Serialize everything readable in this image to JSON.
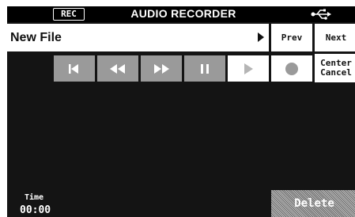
{
  "titlebar": {
    "rec_badge": "REC",
    "title": "AUDIO RECORDER",
    "usb_icon": "usb-icon"
  },
  "file": {
    "name": "New File"
  },
  "nav": {
    "prev_label": "Prev",
    "next_label": "Next",
    "center_line1": "Center",
    "center_line2": "Cancel"
  },
  "transport": [
    {
      "icon": "skip-to-start-icon",
      "enabled": false
    },
    {
      "icon": "rewind-icon",
      "enabled": false
    },
    {
      "icon": "fast-forward-icon",
      "enabled": false
    },
    {
      "icon": "pause-icon",
      "enabled": false
    },
    {
      "icon": "play-icon",
      "enabled": true
    },
    {
      "icon": "record-icon",
      "enabled": true
    }
  ],
  "footer": {
    "time_label": "Time",
    "time_value": "00:00",
    "delete_label": "Delete"
  },
  "colors": {
    "background": "#141414",
    "disabled_button": "#9a9a9a",
    "button": "#ffffff"
  }
}
